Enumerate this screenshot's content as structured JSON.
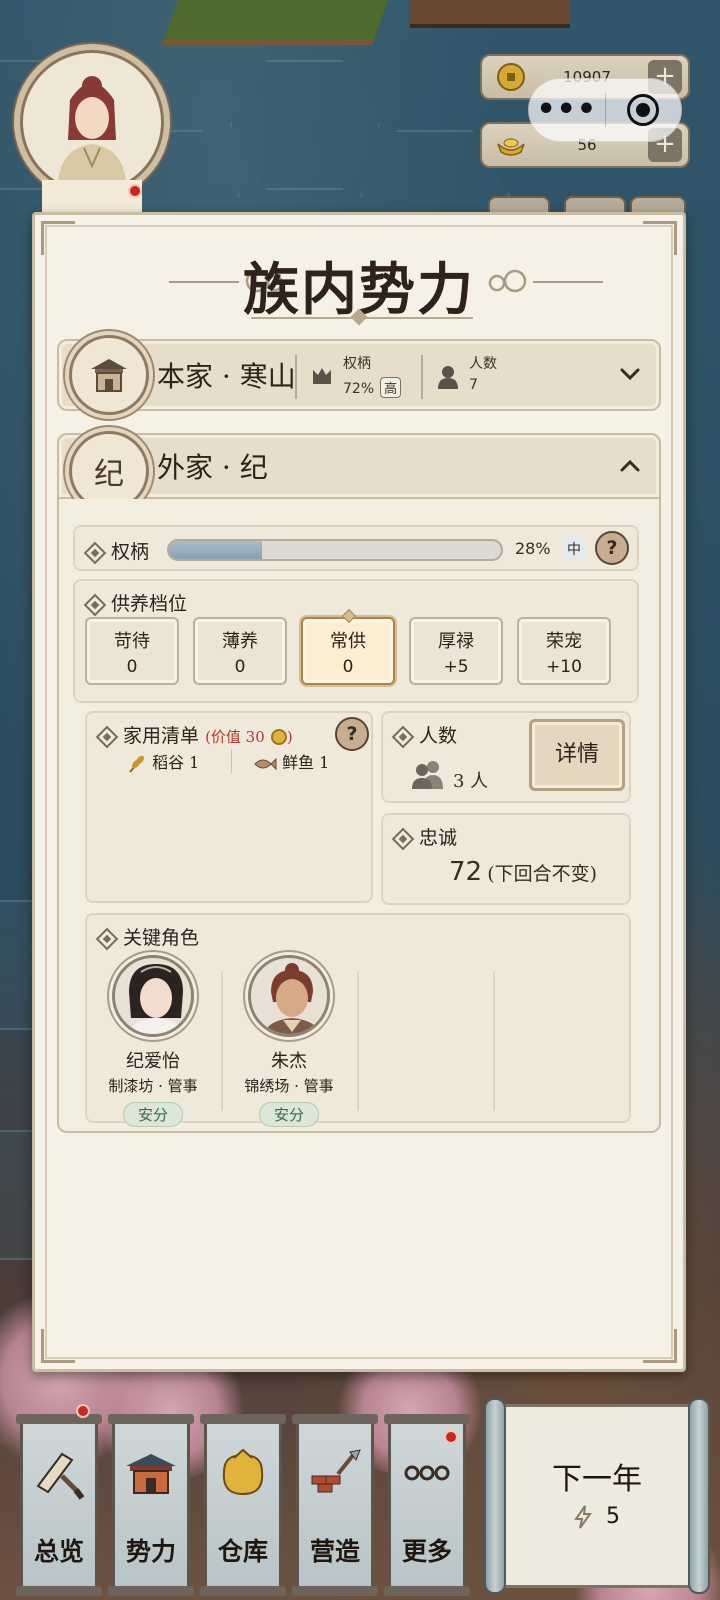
{
  "hud": {
    "coins": "10907",
    "gold": "56",
    "plus_label": "+"
  },
  "panel": {
    "title": "族内势力",
    "main_family": {
      "emblem": "house-emblem",
      "name": "本家 · 寒山",
      "power_label": "权柄",
      "power_value": "72%",
      "power_level": "高",
      "members_label": "人数",
      "members_value": "7"
    },
    "outer_family": {
      "emblem_char": "纪",
      "name": "外家 · 纪",
      "power_label": "权柄",
      "power_percent": 28,
      "power_value": "28%",
      "power_level": "中",
      "support_label": "供养档位",
      "tiers": [
        {
          "label": "苛待",
          "value": "0"
        },
        {
          "label": "薄养",
          "value": "0"
        },
        {
          "label": "常供",
          "value": "0"
        },
        {
          "label": "厚禄",
          "value": "+5"
        },
        {
          "label": "荣宠",
          "value": "+10"
        }
      ],
      "active_tier": 2,
      "household_label": "家用清单",
      "household_value": "(价值 30",
      "household_value_close": ")",
      "household_items": [
        {
          "icon": "grain-icon",
          "label": "稻谷 1"
        },
        {
          "icon": "fish-icon",
          "label": "鲜鱼 1"
        }
      ],
      "members_label": "人数",
      "members_value": "3 人",
      "detail_button": "详情",
      "loyalty_label": "忠诚",
      "loyalty_value": "72",
      "loyalty_note": "(下回合不变)",
      "key_roles_label": "关键角色",
      "key_roles": [
        {
          "name": "纪爱怡",
          "role": "制漆坊 · 管事",
          "status": "安分"
        },
        {
          "name": "朱杰",
          "role": "锦绣场 · 管事",
          "status": "安分"
        }
      ]
    }
  },
  "nav": [
    {
      "label": "总览",
      "icon": "overview-icon"
    },
    {
      "label": "势力",
      "icon": "faction-icon"
    },
    {
      "label": "仓库",
      "icon": "warehouse-icon"
    },
    {
      "label": "营造",
      "icon": "build-icon"
    },
    {
      "label": "更多",
      "icon": "more-icon"
    }
  ],
  "next_year": {
    "label": "下一年",
    "energy": "5"
  },
  "colors": {
    "panel_bg": "#f6f1e6",
    "accent_brown": "#8d7a62",
    "alert_red": "#c8281e",
    "status_green": "#3e6a44"
  }
}
